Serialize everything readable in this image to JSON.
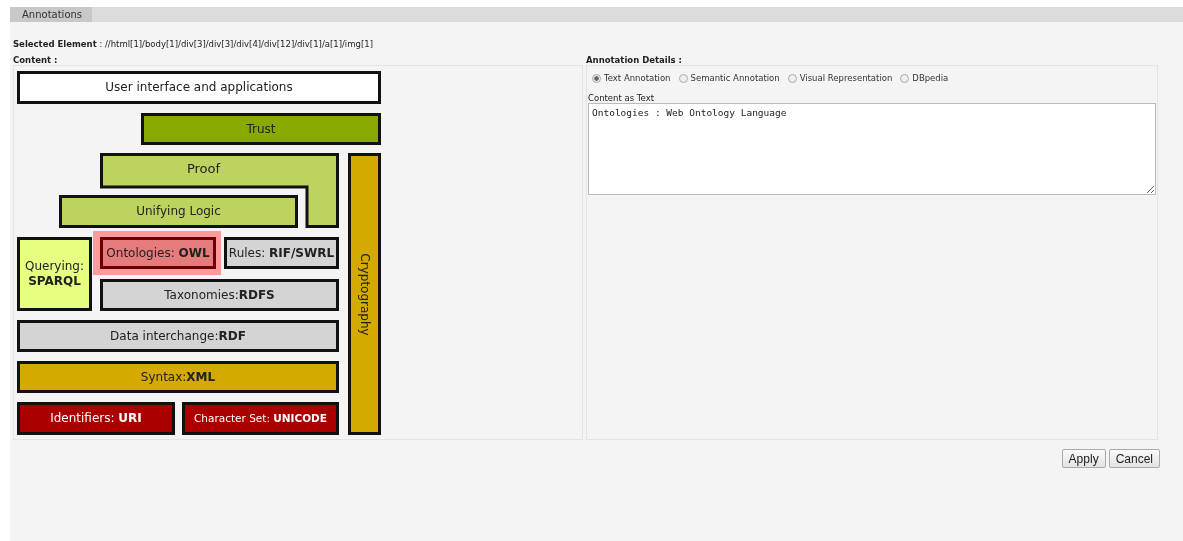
{
  "tabs": [
    {
      "label": "Annotations",
      "selected": true
    }
  ],
  "selected_element": {
    "label": "Selected Element",
    "separator": ":",
    "value": "//html[1]/body[1]/div[3]/div[3]/div[4]/div[12]/div[1]/a[1]/img[1]"
  },
  "content": {
    "label": "Content :",
    "diagram": {
      "blocks": [
        {
          "kind": "box",
          "label": "User interface and applications",
          "color": "#ffffff",
          "selected": false
        },
        {
          "kind": "box",
          "label": "Trust",
          "color": "#88aa00",
          "selected": false
        },
        {
          "kind": "l-shape",
          "label": "Proof",
          "color": "#bcd35f",
          "selected": false
        },
        {
          "kind": "box",
          "label": "Unifying Logic",
          "color": "#bcd35f",
          "selected": false
        },
        {
          "kind": "box",
          "label": "Querying: **SPARQL**",
          "color": "#e5ff80",
          "selected": false
        },
        {
          "kind": "box",
          "label": "Ontologies: **OWL**",
          "color": "#e57b7b",
          "selected": true
        },
        {
          "kind": "box",
          "label": "Rules: **RIF/SWRL**",
          "color": "#d4d4d4",
          "selected": false
        },
        {
          "kind": "box",
          "label": "Taxonomies:**RDFS**",
          "color": "#d4d4d4",
          "selected": false
        },
        {
          "kind": "box",
          "label": "Data interchange:**RDF**",
          "color": "#d4d4d4",
          "selected": false
        },
        {
          "kind": "box",
          "label": "Syntax:**XML**",
          "color": "#d4aa00",
          "selected": false
        },
        {
          "kind": "box",
          "label": "Identifiers: **URI**",
          "color": "#aa0000",
          "selected": false
        },
        {
          "kind": "box",
          "label": "Character Set: **UNICODE**",
          "color": "#aa0000",
          "selected": false
        },
        {
          "kind": "vertical",
          "label": "Cryptography",
          "color": "#d4aa00",
          "selected": false
        }
      ]
    }
  },
  "annotation_details": {
    "label": "Annotation Details :",
    "options": [
      {
        "label": "Text Annotation",
        "selected": true
      },
      {
        "label": "Semantic Annotation",
        "selected": false
      },
      {
        "label": "Visual Representation",
        "selected": false
      },
      {
        "label": "DBpedia",
        "selected": false
      }
    ],
    "field_label": "Content as Text",
    "value": "Ontologies : Web Ontology Language"
  },
  "buttons": [
    "Apply",
    "Cancel"
  ]
}
